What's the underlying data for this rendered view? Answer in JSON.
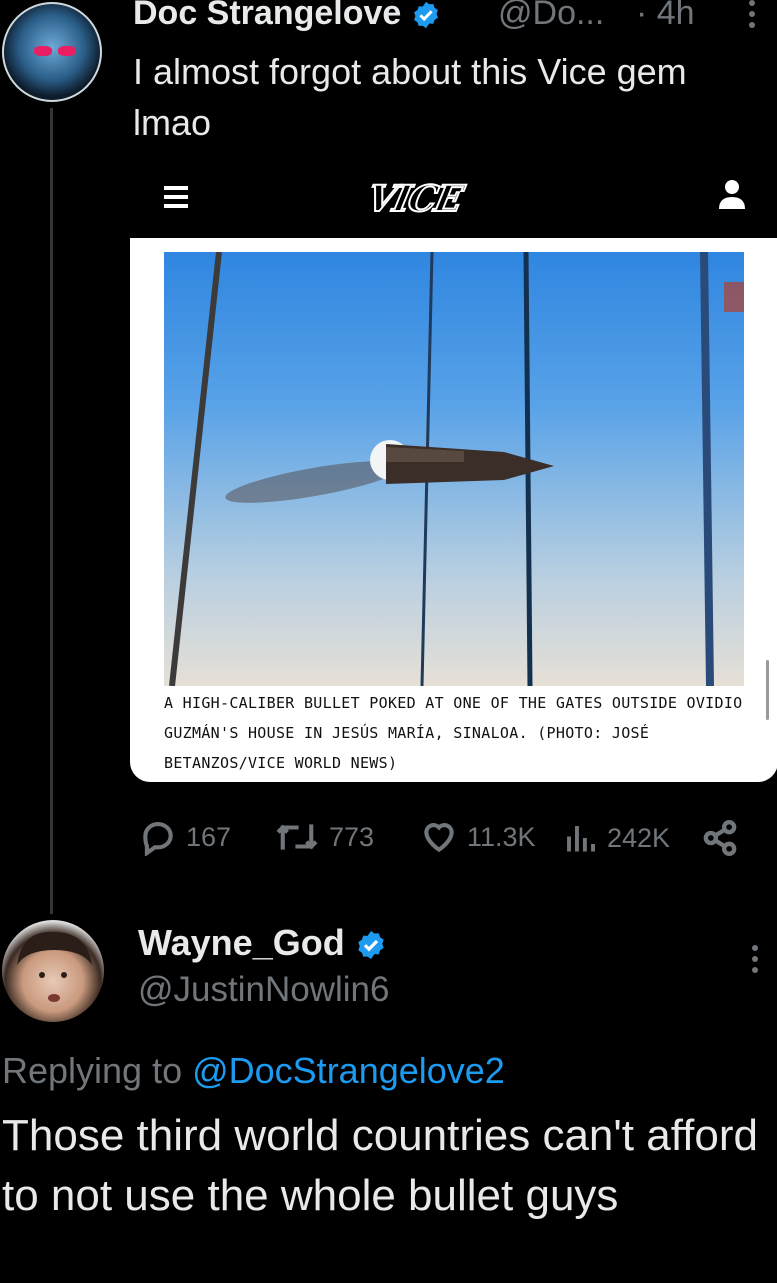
{
  "colors": {
    "background": "#000000",
    "text": "#e7e9ea",
    "muted": "#71767b",
    "link": "#1d9bf0",
    "verified": "#1d9bf0"
  },
  "tweet": {
    "author_name": "Doc Strangelove",
    "author_handle": "@Do...",
    "time": "· 4h",
    "text": "I almost forgot about this Vice gem lmao",
    "embed": {
      "logo": "VICE",
      "caption": "A HIGH-CALIBER BULLET POKED AT ONE OF THE GATES OUTSIDE OVIDIO GUZMÁN'S HOUSE IN JESÚS MARÍA, SINALOA. (PHOTO: JOSÉ BETANZOS/VICE WORLD NEWS)"
    },
    "stats": {
      "replies": "167",
      "retweets": "773",
      "likes": "11.3K",
      "views": "242K"
    },
    "icons": [
      "verified-badge-icon",
      "more-options-icon",
      "hamburger-menu-icon",
      "user-icon",
      "reply-icon",
      "retweet-icon",
      "like-icon",
      "views-icon",
      "share-icon"
    ]
  },
  "reply": {
    "author_name": "Wayne_God",
    "author_handle": "@JustinNowlin6",
    "replying_prefix": "Replying to ",
    "replying_to": "@DocStrangelove2",
    "text": "Those third world countries can't afford to not use the whole bullet guys"
  }
}
